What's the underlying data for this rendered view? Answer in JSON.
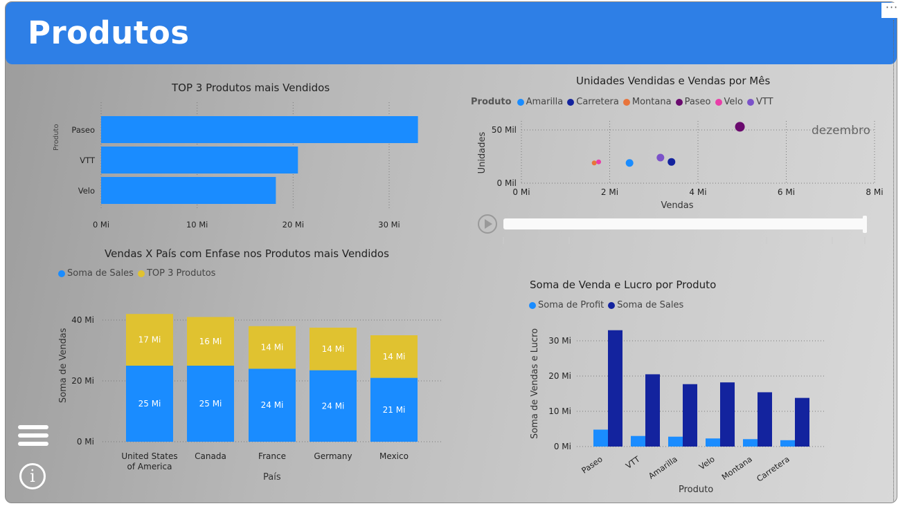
{
  "page": {
    "title": "Produtos",
    "more_label": "···"
  },
  "colors": {
    "header": "#2e7fe6",
    "blue": "#1a8cff",
    "yellow": "#e0c230",
    "navy": "#13239e",
    "profit": "#1a8cff"
  },
  "icons": {
    "menu": "hamburger-icon",
    "info": "info-icon",
    "play": "play-icon"
  },
  "chart_data": [
    {
      "id": "top3",
      "type": "bar",
      "orientation": "horizontal",
      "title": "TOP 3 Produtos mais Vendidos",
      "ylabel": "Produto",
      "categories": [
        "Paseo",
        "VTT",
        "Velo"
      ],
      "values": [
        33.0,
        20.5,
        18.2
      ],
      "xticks": [
        "0 Mi",
        "10 Mi",
        "20 Mi",
        "30 Mi"
      ],
      "xlim": [
        0,
        35
      ],
      "unit": "Mi"
    },
    {
      "id": "scatter",
      "type": "scatter",
      "title": "Unidades Vendidas e Vendas por Mês",
      "legend_title": "Produto",
      "xlabel": "Vendas",
      "ylabel": "Unidades",
      "xticks": [
        "0 Mi",
        "2 Mi",
        "4 Mi",
        "6 Mi",
        "8 Mi"
      ],
      "yticks": [
        "0 Mil",
        "50 Mil"
      ],
      "xlim": [
        0,
        8
      ],
      "ylim": [
        0,
        50
      ],
      "play_axis_current": "dezembro",
      "series": [
        {
          "name": "Amarilla",
          "color": "#1a8cff",
          "points": [
            {
              "x": 2.45,
              "y": 19
            }
          ]
        },
        {
          "name": "Carretera",
          "color": "#13239e",
          "points": [
            {
              "x": 3.4,
              "y": 20
            }
          ]
        },
        {
          "name": "Montana",
          "color": "#e8743b",
          "points": [
            {
              "x": 1.65,
              "y": 19
            }
          ]
        },
        {
          "name": "Paseo",
          "color": "#6a0a6e",
          "points": [
            {
              "x": 4.95,
              "y": 53
            }
          ]
        },
        {
          "name": "Velo",
          "color": "#e83ea8",
          "points": [
            {
              "x": 1.75,
              "y": 20
            }
          ]
        },
        {
          "name": "VTT",
          "color": "#7b52c9",
          "points": [
            {
              "x": 3.15,
              "y": 24
            }
          ]
        }
      ]
    },
    {
      "id": "country",
      "type": "bar",
      "stacked": true,
      "title": "Vendas X País com Enfase nos Produtos mais Vendidos",
      "xlabel": "País",
      "ylabel": "Soma de Vendas",
      "categories": [
        "United States of America",
        "Canada",
        "France",
        "Germany",
        "Mexico"
      ],
      "category_lines": [
        [
          "United States",
          "of America"
        ],
        [
          "Canada"
        ],
        [
          "France"
        ],
        [
          "Germany"
        ],
        [
          "Mexico"
        ]
      ],
      "yticks": [
        "0 Mi",
        "20 Mi",
        "40 Mi"
      ],
      "ylim": [
        0,
        40
      ],
      "series": [
        {
          "name": "Soma de Sales",
          "color": "#1a8cff",
          "values": [
            25,
            25,
            24,
            23.5,
            21
          ],
          "labels": [
            "25 Mi",
            "25 Mi",
            "24 Mi",
            "24 Mi",
            "21 Mi"
          ]
        },
        {
          "name": "TOP 3 Produtos",
          "color": "#e0c230",
          "values": [
            17,
            16,
            14,
            14,
            14
          ],
          "labels": [
            "17 Mi",
            "16 Mi",
            "14 Mi",
            "14 Mi",
            "14 Mi"
          ]
        }
      ]
    },
    {
      "id": "profit",
      "type": "bar",
      "title": "Soma de Venda e Lucro por Produto",
      "xlabel": "Produto",
      "ylabel": "Soma de Vendas e Lucro",
      "categories": [
        "Paseo",
        "VTT",
        "Amarilla",
        "Velo",
        "Montana",
        "Carretera"
      ],
      "yticks": [
        "0 Mi",
        "10 Mi",
        "20 Mi",
        "30 Mi"
      ],
      "ylim": [
        0,
        33
      ],
      "series": [
        {
          "name": "Soma de Profit",
          "color": "#1a8cff",
          "values": [
            4.8,
            3.0,
            2.8,
            2.3,
            2.1,
            1.8
          ]
        },
        {
          "name": "Soma de Sales",
          "color": "#13239e",
          "values": [
            33.0,
            20.5,
            17.7,
            18.2,
            15.4,
            13.8
          ]
        }
      ]
    }
  ]
}
